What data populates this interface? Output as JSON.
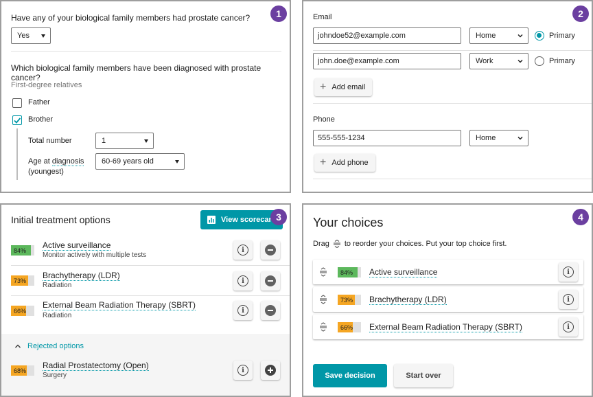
{
  "panel1": {
    "badge": "1",
    "question1": "Have any of your biological family members had prostate cancer?",
    "answer1": "Yes",
    "question2": "Which biological family members have been diagnosed with prostate cancer?",
    "section_label": "First-degree relatives",
    "relatives": [
      {
        "label": "Father",
        "checked": false
      },
      {
        "label": "Brother",
        "checked": true
      }
    ],
    "total_number_label": "Total number",
    "total_number_value": "1",
    "age_label_prefix": "Age at ",
    "age_label_link": "diagnosis",
    "age_label_sub": "(youngest)",
    "age_value": "60-69 years old"
  },
  "panel2": {
    "badge": "2",
    "email_heading": "Email",
    "emails": [
      {
        "value": "johndoe52@example.com",
        "type": "Home",
        "primary_label": "Primary",
        "primary": true
      },
      {
        "value": "john.doe@example.com",
        "type": "Work",
        "primary_label": "Primary",
        "primary": false
      }
    ],
    "add_email": "Add email",
    "phone_heading": "Phone",
    "phone": {
      "value": "555-555-1234",
      "type": "Home"
    },
    "add_phone": "Add phone"
  },
  "panel3": {
    "badge": "3",
    "title": "Initial treatment options",
    "scorecard_button": "View scorecard",
    "options": [
      {
        "score": "84%",
        "score_value": 84,
        "color": "#5cb85c",
        "name": "Active surveillance",
        "sub": "Monitor actively with multiple tests"
      },
      {
        "score": "73%",
        "score_value": 73,
        "color": "#f5a623",
        "name": "Brachytherapy (LDR)",
        "sub": "Radiation"
      },
      {
        "score": "66%",
        "score_value": 66,
        "color": "#f5a623",
        "name": "External Beam Radiation Therapy (SBRT)",
        "sub": "Radiation"
      }
    ],
    "rejected_label": "Rejected options",
    "rejected": [
      {
        "score": "68%",
        "score_value": 68,
        "color": "#f5a623",
        "name": "Radial Prostatectomy (Open)",
        "sub": "Surgery"
      }
    ]
  },
  "panel4": {
    "badge": "4",
    "title": "Your choices",
    "instruction_before": "Drag",
    "instruction_after": "to reorder your choices. Put your top choice first.",
    "choices": [
      {
        "score": "84%",
        "score_value": 84,
        "color": "#5cb85c",
        "name": "Active surveillance"
      },
      {
        "score": "73%",
        "score_value": 73,
        "color": "#f5a623",
        "name": "Brachytherapy (LDR)"
      },
      {
        "score": "66%",
        "score_value": 66,
        "color": "#f5a623",
        "name": "External Beam Radiation Therapy (SBRT)"
      }
    ],
    "save_button": "Save decision",
    "start_over_button": "Start over"
  },
  "colors": {
    "accent": "#0097a7",
    "badge": "#6b3fa0"
  }
}
